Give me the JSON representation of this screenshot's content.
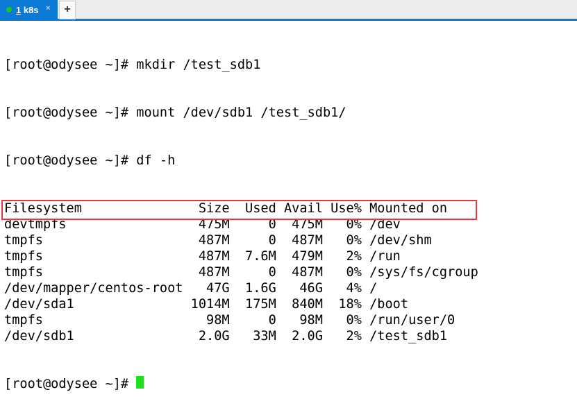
{
  "tab": {
    "number": "1",
    "name": " k8s",
    "close": "×",
    "add": "+",
    "status_color": "#18c918"
  },
  "commands": [
    "[root@odysee ~]# mkdir /test_sdb1",
    "[root@odysee ~]# mount /dev/sdb1 /test_sdb1/",
    "[root@odysee ~]# df -h"
  ],
  "df": {
    "headers": [
      "Filesystem",
      "Size",
      "Used",
      "Avail",
      "Use%",
      "Mounted on"
    ],
    "rows": [
      [
        "devtmpfs",
        "475M",
        "0",
        "475M",
        "0%",
        "/dev"
      ],
      [
        "tmpfs",
        "487M",
        "0",
        "487M",
        "0%",
        "/dev/shm"
      ],
      [
        "tmpfs",
        "487M",
        "7.6M",
        "479M",
        "2%",
        "/run"
      ],
      [
        "tmpfs",
        "487M",
        "0",
        "487M",
        "0%",
        "/sys/fs/cgroup"
      ],
      [
        "/dev/mapper/centos-root",
        "47G",
        "1.6G",
        "46G",
        "4%",
        "/"
      ],
      [
        "/dev/sda1",
        "1014M",
        "175M",
        "840M",
        "18%",
        "/boot"
      ],
      [
        "tmpfs",
        "98M",
        "0",
        "98M",
        "0%",
        "/run/user/0"
      ],
      [
        "/dev/sdb1",
        "2.0G",
        "33M",
        "2.0G",
        "2%",
        "/test_sdb1"
      ]
    ]
  },
  "prompt": "[root@odysee ~]# "
}
